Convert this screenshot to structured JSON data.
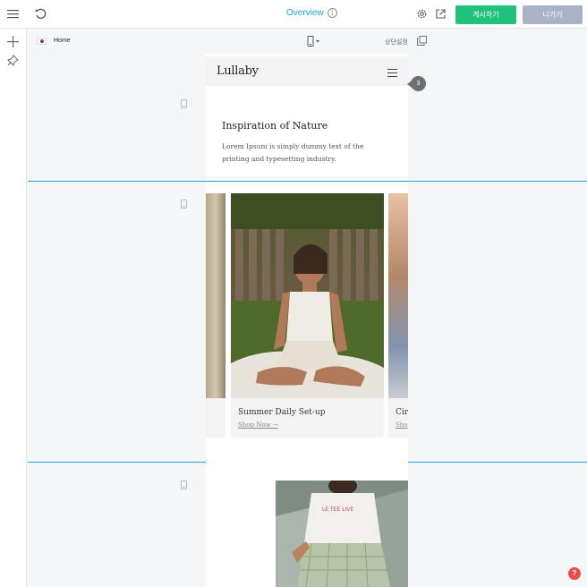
{
  "topbar": {
    "overview_label": "Overview",
    "info_glyph": "i",
    "publish_label": "게시하기",
    "exit_label": "나가기",
    "icons": [
      "menu-icon",
      "undo-icon",
      "info-icon",
      "gear-icon",
      "external-link-icon"
    ]
  },
  "leftbar": {
    "icons": [
      "plus-icon",
      "pin-icon"
    ]
  },
  "pagebar": {
    "page_name": "Home",
    "section_settings_label": "상단설정",
    "icons": [
      "flag-icon",
      "mobile-device-icon",
      "copy-icon"
    ]
  },
  "site": {
    "logo": "Lullaby",
    "badge_count": "3",
    "intro": {
      "heading": "Inspiration of Nature",
      "body": "Lorem Ipsum is simply dummy text of the printing and typesetting industry."
    },
    "slider": {
      "cards": [
        {
          "title": "Summer Daily Set-up",
          "link": "Shop Now →"
        },
        {
          "title": "Cir",
          "link": "Sho"
        }
      ],
      "prev_glyph": "‹",
      "next_glyph": "›"
    },
    "photo_tshirt_text": "LE TEE LIVE"
  },
  "help_glyph": "?",
  "colors": {
    "accent": "#1aa3e8",
    "publish": "#1fc17b",
    "exit": "#a9b3c8",
    "help": "#ee4b4b"
  }
}
